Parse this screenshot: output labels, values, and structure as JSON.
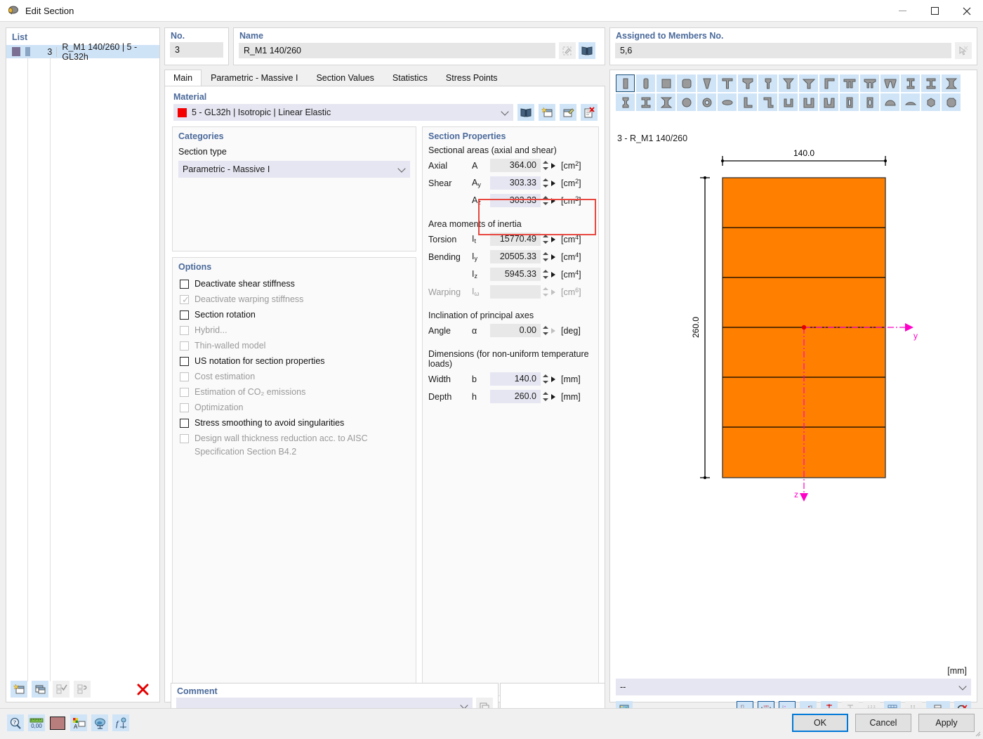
{
  "window": {
    "title": "Edit Section",
    "icon": "section-icon",
    "minimize": "–",
    "maximize": "□",
    "close": "✕"
  },
  "list": {
    "label": "List",
    "rows": [
      {
        "no": "3",
        "text": "R_M1 140/260 | 5 - GL32h"
      }
    ],
    "buttons": [
      "new-section-icon",
      "copy-section-icon",
      "check-all-icon",
      "reset-icon",
      "delete-icon"
    ]
  },
  "no_field": {
    "label": "No.",
    "value": "3"
  },
  "name_field": {
    "label": "Name",
    "value": "R_M1 140/260",
    "buttons": [
      "edit-name-icon",
      "library-icon"
    ]
  },
  "assigned": {
    "label": "Assigned to Members No.",
    "value": "5,6",
    "button": "pick-members-icon"
  },
  "tabs": [
    {
      "label": "Main",
      "active": true
    },
    {
      "label": "Parametric - Massive I",
      "active": false
    },
    {
      "label": "Section Values",
      "active": false
    },
    {
      "label": "Statistics",
      "active": false
    },
    {
      "label": "Stress Points",
      "active": false
    }
  ],
  "material": {
    "label": "Material",
    "value": "5 - GL32h | Isotropic | Linear Elastic",
    "swatch_color": "#f40000",
    "buttons": [
      "material-library-icon",
      "new-material-icon",
      "edit-material-icon",
      "delete-material-icon"
    ]
  },
  "categories": {
    "label": "Categories",
    "section_type_label": "Section type",
    "section_type_value": "Parametric - Massive I"
  },
  "options": {
    "label": "Options",
    "items": [
      {
        "label": "Deactivate shear stiffness",
        "checked": false,
        "enabled": true
      },
      {
        "label": "Deactivate warping stiffness",
        "checked": true,
        "enabled": false
      },
      {
        "label": "Section rotation",
        "checked": false,
        "enabled": true
      },
      {
        "label": "Hybrid...",
        "checked": false,
        "enabled": false
      },
      {
        "label": "Thin-walled model",
        "checked": false,
        "enabled": false
      },
      {
        "label": "US notation for section properties",
        "checked": false,
        "enabled": true
      },
      {
        "label": "Cost estimation",
        "checked": false,
        "enabled": false
      },
      {
        "label": "Estimation of CO₂ emissions",
        "checked": false,
        "enabled": false
      },
      {
        "label": "Optimization",
        "checked": false,
        "enabled": false
      },
      {
        "label": "Stress smoothing to avoid singularities",
        "checked": false,
        "enabled": true
      },
      {
        "label": "Design wall thickness reduction acc. to AISC Specification Section B4.2",
        "checked": false,
        "enabled": false
      }
    ]
  },
  "section_properties": {
    "label": "Section Properties",
    "groups": [
      {
        "heading": "Sectional areas (axial and shear)",
        "rows": [
          {
            "label": "Axial",
            "symbol": "A",
            "sub": "",
            "value": "364.00",
            "unit": "cm",
            "exp": "2",
            "enabled": true,
            "highlight": false
          },
          {
            "label": "Shear",
            "symbol": "A",
            "sub": "y",
            "value": "303.33",
            "unit": "cm",
            "exp": "2",
            "enabled": true,
            "highlight": true
          },
          {
            "label": "",
            "symbol": "A",
            "sub": "z",
            "value": "303.33",
            "unit": "cm",
            "exp": "2",
            "enabled": true,
            "highlight": true
          }
        ]
      },
      {
        "heading": "Area moments of inertia",
        "rows": [
          {
            "label": "Torsion",
            "symbol": "I",
            "sub": "t",
            "value": "15770.49",
            "unit": "cm",
            "exp": "4",
            "enabled": true,
            "highlight": false
          },
          {
            "label": "Bending",
            "symbol": "I",
            "sub": "y",
            "value": "20505.33",
            "unit": "cm",
            "exp": "4",
            "enabled": true,
            "highlight": false
          },
          {
            "label": "",
            "symbol": "I",
            "sub": "z",
            "value": "5945.33",
            "unit": "cm",
            "exp": "4",
            "enabled": true,
            "highlight": false
          },
          {
            "label": "Warping",
            "symbol": "I",
            "sub": "ω",
            "value": "",
            "unit": "cm",
            "exp": "6",
            "enabled": false,
            "highlight": false
          }
        ]
      },
      {
        "heading": "Inclination of principal axes",
        "rows": [
          {
            "label": "Angle",
            "symbol": "α",
            "sub": "",
            "value": "0.00",
            "unit": "deg",
            "exp": "",
            "enabled": true,
            "highlight": false
          }
        ]
      },
      {
        "heading": "Dimensions (for non-uniform temperature loads)",
        "rows": [
          {
            "label": "Width",
            "symbol": "b",
            "sub": "",
            "value": "140.0",
            "unit": "mm",
            "exp": "",
            "enabled": true,
            "highlight": false
          },
          {
            "label": "Depth",
            "symbol": "h",
            "sub": "",
            "value": "260.0",
            "unit": "mm",
            "exp": "",
            "enabled": true,
            "highlight": false
          }
        ]
      }
    ]
  },
  "comment": {
    "label": "Comment",
    "value": "",
    "button": "comment-list-icon"
  },
  "shape_toolbar": {
    "row1": [
      "rect-tall-shape-icon",
      "rect-rounded-tall-shape-icon",
      "square-shape-icon",
      "square-rounded-shape-icon",
      "taper-shape-icon",
      "t-shape-icon",
      "t-wide-shape-icon",
      "i-narrow-shape-icon",
      "inverted-t-shape-icon",
      "inverted-t-wide-shape-icon",
      "angle-t-shape-icon",
      "double-t-shape-icon",
      "double-t-wide-shape-icon",
      "triple-t-shape-icon",
      "i-beam-shape-icon",
      "i-beam2-shape-icon",
      "i-beam3-shape-icon"
    ],
    "row2": [
      "i-stub-shape-icon",
      "i-tall-shape-icon",
      "i-taper-shape-icon",
      "circle-shape-icon",
      "ring-shape-icon",
      "ellipse-shape-icon",
      "l-shape-icon",
      "z-shape-icon",
      "u-shape-icon",
      "u-wide-shape-icon",
      "u-taper-shape-icon",
      "hollow-rect-shape-icon",
      "hollow-oval-shape-icon",
      "dome-shape-icon",
      "arc-shape-icon",
      "hexagon-shape-icon",
      "octagon-shape-icon"
    ],
    "selected_index": 0
  },
  "preview": {
    "title": "3 - R_M1 140/260",
    "width_dim": "140.0",
    "depth_dim": "260.0",
    "axis_y": "y",
    "axis_z": "z",
    "unit_label": "[mm]",
    "fill_color": "#FF8000",
    "axis_color": "#ff00c8",
    "layers": 6
  },
  "view_combo": {
    "value": "--"
  },
  "view_toolbar": {
    "left": [
      "render-image-icon"
    ],
    "right": [
      {
        "name": "show-section-outline-icon",
        "active": true,
        "enabled": true
      },
      {
        "name": "show-dimensions-icon",
        "active": true,
        "enabled": true
      },
      {
        "name": "show-axes-icon",
        "active": true,
        "enabled": true
      },
      {
        "name": "show-shear-center-icon",
        "active": false,
        "enabled": true
      },
      {
        "name": "show-stress-points-icon",
        "active": false,
        "enabled": true
      },
      {
        "name": "show-parts-icon",
        "active": false,
        "enabled": false
      },
      {
        "name": "show-numbering-icon",
        "active": false,
        "enabled": false
      },
      {
        "name": "show-grid-icon",
        "active": false,
        "enabled": true
      },
      {
        "name": "show-mesh-icon",
        "active": false,
        "enabled": false
      },
      {
        "name": "print-icon",
        "active": false,
        "enabled": true
      },
      {
        "name": "print-dropdown-icon",
        "active": false,
        "enabled": true
      },
      {
        "name": "reset-view-icon",
        "active": false,
        "enabled": true
      }
    ]
  },
  "bottom_icons": [
    "help-icon",
    "units-icon",
    "color-swatch-icon",
    "display-props-icon",
    "view-settings-icon",
    "function-icon"
  ],
  "dialog_buttons": [
    {
      "label": "OK",
      "default": true
    },
    {
      "label": "Cancel",
      "default": false
    },
    {
      "label": "Apply",
      "default": false
    }
  ]
}
